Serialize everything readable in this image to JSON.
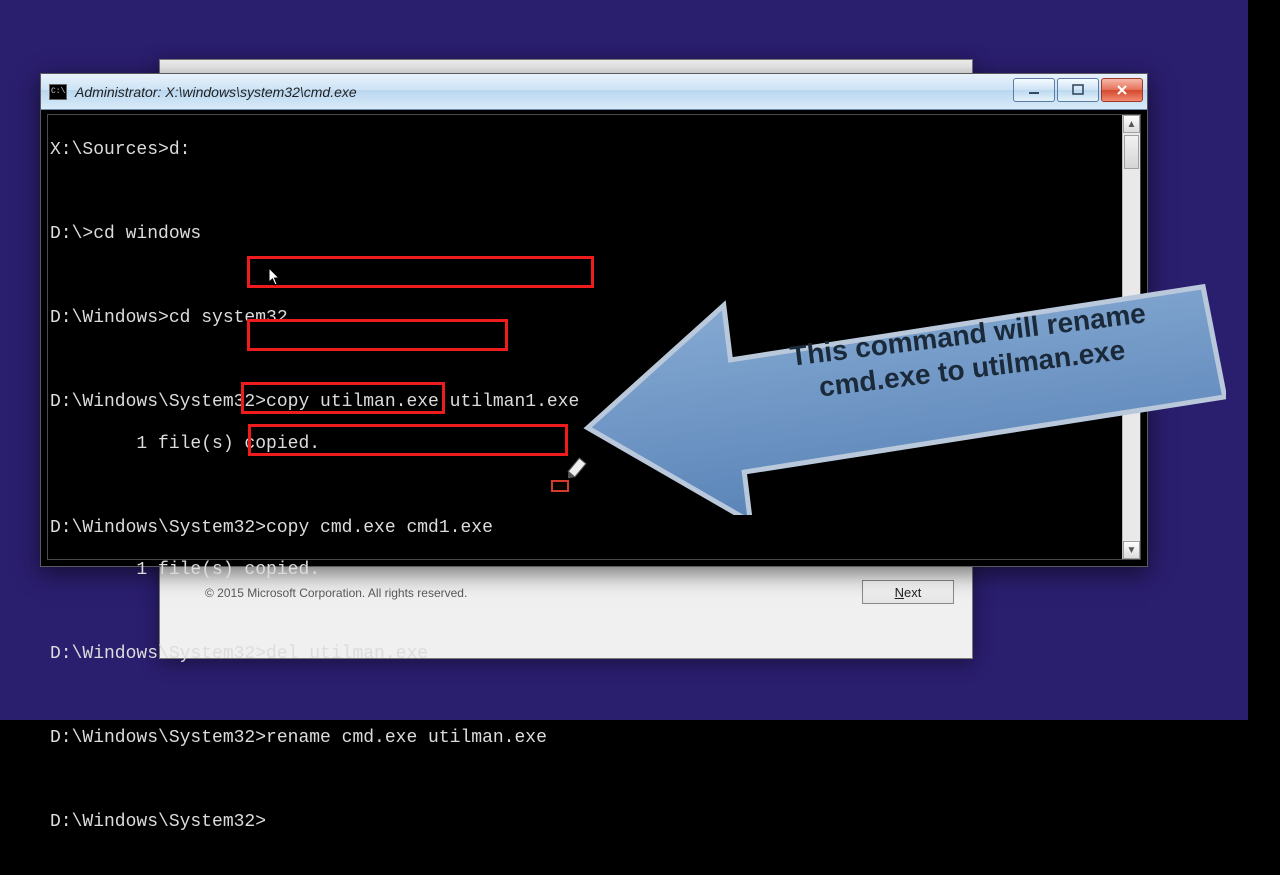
{
  "window": {
    "title": "Administrator: X:\\windows\\system32\\cmd.exe"
  },
  "terminal": {
    "l1": "X:\\Sources>d:",
    "l2": "D:\\>cd windows",
    "l3": "D:\\Windows>cd system32",
    "l4": "D:\\Windows\\System32>copy utilman.exe utilman1.exe",
    "l5": "        1 file(s) copied.",
    "l6": "D:\\Windows\\System32>copy cmd.exe cmd1.exe",
    "l7": "        1 file(s) copied.",
    "l8": "D:\\Windows\\System32>del utilman.exe",
    "l9": "D:\\Windows\\System32>rename cmd.exe utilman.exe",
    "l10": "D:\\Windows\\System32>"
  },
  "dialog": {
    "copyright": "© 2015 Microsoft Corporation. All rights reserved.",
    "next_underline": "N",
    "next_rest": "ext"
  },
  "callout": {
    "line1": "This command will rename",
    "line2": "cmd.exe to utilman.exe"
  },
  "colors": {
    "desktop_bg": "#2a1e6e",
    "highlight": "#ee1c1c",
    "callout_fill": "#6e96c5",
    "callout_stroke": "#a8b8ca"
  }
}
